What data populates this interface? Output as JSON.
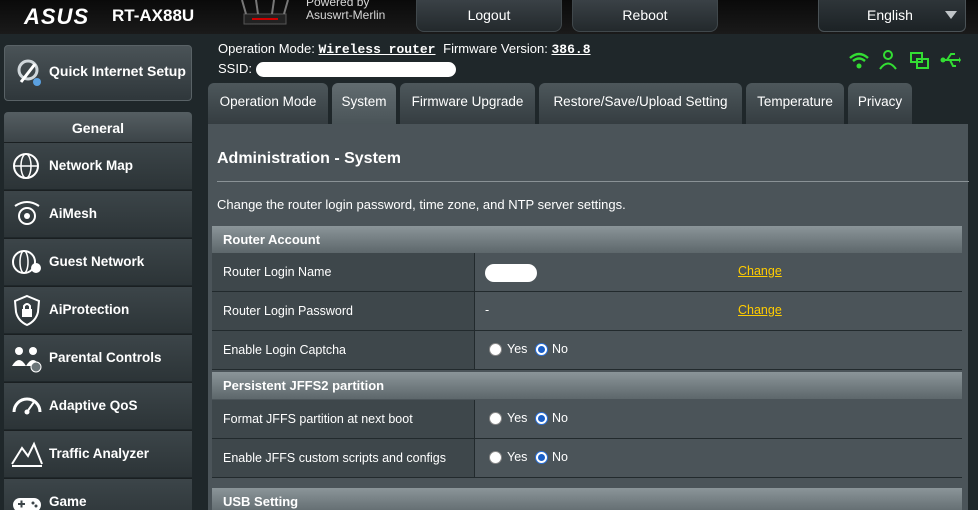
{
  "brand": {
    "logo": "ASUS",
    "model": "RT-AX88U",
    "powered_line1": "Powered by",
    "powered_line2": "Asuswrt-Merlin"
  },
  "topbar": {
    "logout": "Logout",
    "reboot": "Reboot",
    "language": "English"
  },
  "sidebar": {
    "quick_setup": "Quick Internet Setup",
    "section": "General",
    "items": [
      {
        "label": "Network Map",
        "icon": "globe-network-icon"
      },
      {
        "label": "AiMesh",
        "icon": "aimesh-icon"
      },
      {
        "label": "Guest Network",
        "icon": "guest-network-icon"
      },
      {
        "label": "AiProtection",
        "icon": "shield-lock-icon"
      },
      {
        "label": "Parental Controls",
        "icon": "family-icon"
      },
      {
        "label": "Adaptive QoS",
        "icon": "speedometer-icon"
      },
      {
        "label": "Traffic Analyzer",
        "icon": "traffic-analyzer-icon"
      },
      {
        "label": "Game",
        "icon": "gamepad-icon"
      }
    ]
  },
  "header": {
    "op_mode_label": "Operation Mode:",
    "op_mode_value": "Wireless router",
    "fw_label": "Firmware Version:",
    "fw_value": "386.8",
    "ssid_label": "SSID:"
  },
  "status_icons": [
    "wifi-icon",
    "user-icon",
    "dual-window-icon",
    "usb-icon"
  ],
  "tabs": [
    "Operation Mode",
    "System",
    "Firmware Upgrade",
    "Restore/Save/Upload Setting",
    "Temperature",
    "Privacy"
  ],
  "active_tab": "System",
  "main": {
    "title": "Administration - System",
    "description": "Change the router login password, time zone, and NTP server settings.",
    "sections": [
      {
        "title": "Router Account",
        "rows": [
          {
            "label": "Router Login Name",
            "value": "",
            "action": "Change"
          },
          {
            "label": "Router Login Password",
            "value": "-",
            "action": "Change"
          },
          {
            "label": "Enable Login Captcha",
            "yes": "Yes",
            "no": "No",
            "selected": "No"
          }
        ]
      },
      {
        "title": "Persistent JFFS2 partition",
        "rows": [
          {
            "label": "Format JFFS partition at next boot",
            "yes": "Yes",
            "no": "No",
            "selected": "No"
          },
          {
            "label": "Enable JFFS custom scripts and configs",
            "yes": "Yes",
            "no": "No",
            "selected": "No"
          }
        ]
      },
      {
        "title": "USB Setting",
        "rows": []
      }
    ]
  },
  "colors": {
    "accent_link": "#ffcc00",
    "status_green": "#33dd33",
    "panel": "#4b5459"
  }
}
